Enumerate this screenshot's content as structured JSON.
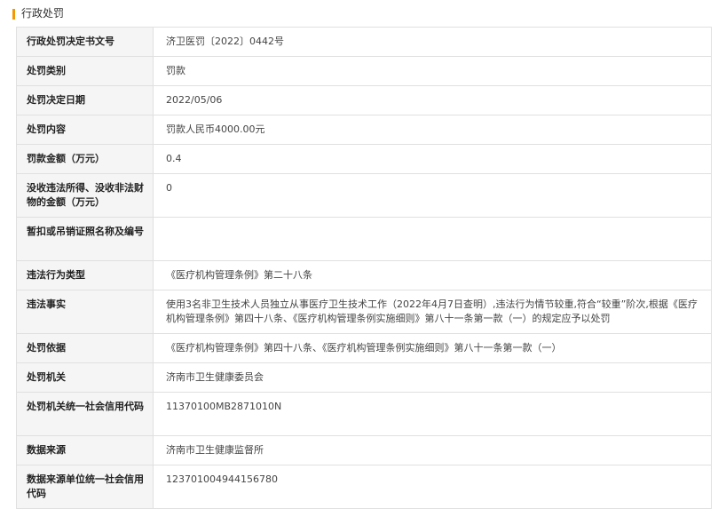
{
  "section": {
    "title": "行政处罚"
  },
  "colors": {
    "accent": "#f39800",
    "label_bg": "#f5f5f5",
    "border": "#e0e0e0"
  },
  "rows": [
    {
      "label": "行政处罚决定书文号",
      "value": "济卫医罚〔2022〕0442号"
    },
    {
      "label": "处罚类别",
      "value": "罚款"
    },
    {
      "label": "处罚决定日期",
      "value": "2022/05/06"
    },
    {
      "label": "处罚内容",
      "value": "罚款人民币4000.00元"
    },
    {
      "label": "罚款金额（万元）",
      "value": "0.4"
    },
    {
      "label": "没收违法所得、没收非法财物的金额（万元）",
      "value": "0"
    },
    {
      "label": "暂扣或吊销证照名称及编号",
      "value": ""
    },
    {
      "label": "违法行为类型",
      "value": "《医疗机构管理条例》第二十八条"
    },
    {
      "label": "违法事实",
      "value": "使用3名非卫生技术人员独立从事医疗卫生技术工作（2022年4月7日查明）,违法行为情节较重,符合“较重”阶次,根据《医疗机构管理条例》第四十八条、《医疗机构管理条例实施细则》第八十一条第一款（一）的规定应予以处罚"
    },
    {
      "label": "处罚依据",
      "value": "《医疗机构管理条例》第四十八条、《医疗机构管理条例实施细则》第八十一条第一款（一）"
    },
    {
      "label": "处罚机关",
      "value": "济南市卫生健康委员会"
    },
    {
      "label": "处罚机关统一社会信用代码",
      "value": "11370100MB2871010N"
    },
    {
      "label": "数据来源",
      "value": "济南市卫生健康监督所"
    },
    {
      "label": "数据来源单位统一社会信用代码",
      "value": "123701004944156780"
    }
  ]
}
